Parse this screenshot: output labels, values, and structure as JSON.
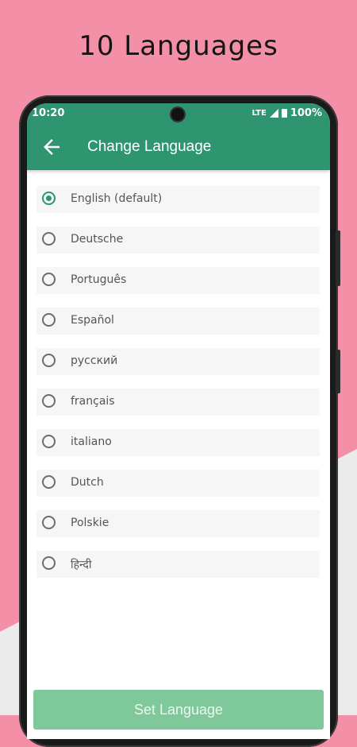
{
  "headline": "10 Languages",
  "status_bar": {
    "time": "10:20",
    "network": "LTE",
    "battery": "100%"
  },
  "app_bar": {
    "title": "Change Language",
    "back_icon": "arrow-left-icon"
  },
  "languages": [
    {
      "label": "English (default)",
      "selected": true
    },
    {
      "label": "Deutsche",
      "selected": false
    },
    {
      "label": "Português",
      "selected": false
    },
    {
      "label": "Español",
      "selected": false
    },
    {
      "label": "русский",
      "selected": false
    },
    {
      "label": "français",
      "selected": false
    },
    {
      "label": "italiano",
      "selected": false
    },
    {
      "label": "Dutch",
      "selected": false
    },
    {
      "label": "Polskie",
      "selected": false
    },
    {
      "label": "हिन्दी",
      "selected": false
    }
  ],
  "set_button": {
    "label": "Set Language"
  },
  "colors": {
    "accent": "#2f9470",
    "background": "#f48fa8",
    "button": "#7fc89a"
  }
}
